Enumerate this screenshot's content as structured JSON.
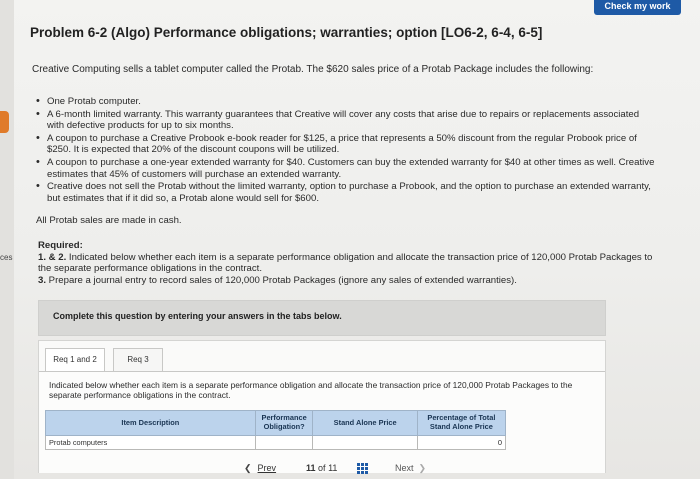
{
  "header": {
    "check_button": "Check my work"
  },
  "side": {
    "label": "ces"
  },
  "problem": {
    "title": "Problem 6-2 (Algo) Performance obligations; warranties; option [LO6-2, 6-4, 6-5]",
    "intro": "Creative Computing sells a tablet computer called the Protab. The $620 sales price of a Protab Package includes the following:",
    "items": [
      "One Protab computer.",
      "A 6-month limited warranty. This warranty guarantees that Creative will cover any costs that arise due to repairs or replacements associated with defective products for up to six months.",
      "A coupon to purchase a Creative Probook e-book reader for $125, a price that represents a 50% discount from the regular Probook price of $250. It is expected that 20% of the discount coupons will be utilized.",
      "A coupon to purchase a one-year extended warranty for $40. Customers can buy the extended warranty for $40 at other times as well. Creative estimates that 45% of customers will purchase an extended warranty.",
      "Creative does not sell the Protab without the limited warranty, option to purchase a Probook, and the option to purchase an extended warranty, but estimates that if it did so, a Protab alone would sell for $600."
    ],
    "cash_note": "All Protab sales are made in cash.",
    "required_heading": "Required:",
    "required_1_num": "1. & 2.",
    "required_1_text": " Indicated below whether each item is a separate performance obligation and allocate the transaction price of 120,000 Protab Packages to the separate performance obligations in the contract.",
    "required_3_num": "3.",
    "required_3_text": " Prepare a journal entry to record sales of 120,000 Protab Packages (ignore any sales of extended warranties)."
  },
  "instruction": "Complete this question by entering your answers in the tabs below.",
  "tabs": [
    {
      "label": "Req 1 and 2"
    },
    {
      "label": "Req 3"
    }
  ],
  "tab_content": {
    "text": "Indicated below whether each item is a separate performance obligation and allocate the transaction price of 120,000 Protab Packages to the separate performance obligations in the contract.",
    "table": {
      "headers": [
        "Item Description",
        "Performance Obligation?",
        "Stand Alone Price",
        "Percentage of Total Stand Alone Price"
      ],
      "rows": [
        {
          "description": "Protab computers",
          "obligation": "",
          "stand_alone_price": "",
          "percentage": "0"
        }
      ]
    }
  },
  "pager": {
    "prev": "Prev",
    "current": "11",
    "of": "of",
    "total": "11",
    "next": "Next"
  }
}
